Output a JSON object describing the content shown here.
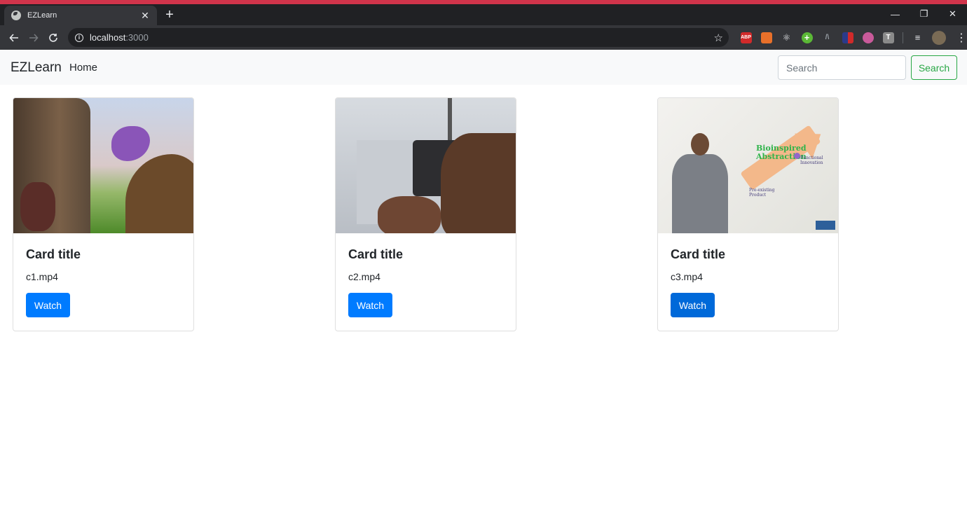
{
  "browser": {
    "tab_title": "EZLearn",
    "tab_close": "✕",
    "new_tab": "+",
    "url_host": "localhost",
    "url_port": ":3000",
    "window_controls": [
      "—",
      "❐",
      "✕"
    ],
    "accent_color": "#d1344b",
    "extensions": [
      {
        "name": "abp-extension-icon",
        "label": "ABP",
        "color": "#d12a2a"
      },
      {
        "name": "brave-extension-icon",
        "label": "",
        "color": "#e8702a"
      },
      {
        "name": "react-extension-icon",
        "label": "⚛",
        "color": "#35363a"
      },
      {
        "name": "plus-extension-icon",
        "label": "+",
        "color": "#5bb836"
      },
      {
        "name": "ruler-extension-icon",
        "label": "/\\",
        "color": "#35363a"
      },
      {
        "name": "flag-extension-icon",
        "label": "",
        "color": "#ffffff"
      },
      {
        "name": "eye-extension-icon",
        "label": "",
        "color": "#c95a9a"
      },
      {
        "name": "text-extension-icon",
        "label": "T",
        "color": "#8a8a8a"
      }
    ]
  },
  "navbar": {
    "brand": "EZLearn",
    "home": "Home",
    "search_placeholder": "Search",
    "search_button": "Search"
  },
  "cards": [
    {
      "title": "Card title",
      "text": "c1.mp4",
      "button": "Watch"
    },
    {
      "title": "Card title",
      "text": "c2.mp4",
      "button": "Watch"
    },
    {
      "title": "Card title",
      "text": "c3.mp4",
      "button": "Watch"
    }
  ],
  "thumb3_text": {
    "main": "Bioinspired Abstraction",
    "functional": "Functional Innovation",
    "pre": "Pre-existing Product"
  }
}
